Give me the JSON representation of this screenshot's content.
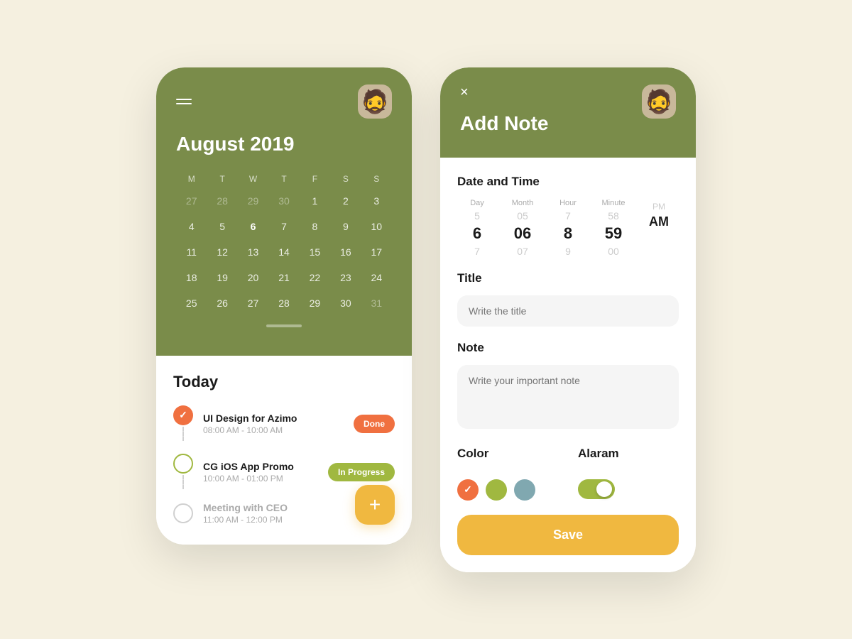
{
  "calendar": {
    "month_title": "August 2019",
    "avatar_emoji": "🧔",
    "day_headers": [
      "M",
      "T",
      "W",
      "T",
      "F",
      "S",
      "S"
    ],
    "weeks": [
      [
        {
          "d": "27",
          "other": true
        },
        {
          "d": "28",
          "other": true
        },
        {
          "d": "29",
          "other": true
        },
        {
          "d": "30",
          "other": true
        },
        {
          "d": "1"
        },
        {
          "d": "2"
        },
        {
          "d": "3"
        }
      ],
      [
        {
          "d": "4"
        },
        {
          "d": "5"
        },
        {
          "d": "6",
          "selected": true
        },
        {
          "d": "7"
        },
        {
          "d": "8"
        },
        {
          "d": "9"
        },
        {
          "d": "10"
        }
      ],
      [
        {
          "d": "11"
        },
        {
          "d": "12"
        },
        {
          "d": "13"
        },
        {
          "d": "14"
        },
        {
          "d": "15"
        },
        {
          "d": "16"
        },
        {
          "d": "17"
        }
      ],
      [
        {
          "d": "18"
        },
        {
          "d": "19"
        },
        {
          "d": "20"
        },
        {
          "d": "21"
        },
        {
          "d": "22"
        },
        {
          "d": "23"
        },
        {
          "d": "24"
        }
      ],
      [
        {
          "d": "25"
        },
        {
          "d": "26"
        },
        {
          "d": "27"
        },
        {
          "d": "28"
        },
        {
          "d": "29"
        },
        {
          "d": "30"
        },
        {
          "d": "31",
          "other": true
        }
      ]
    ],
    "today_label": "Today",
    "tasks": [
      {
        "name": "UI Design for Azimo",
        "time": "08:00 AM - 10:00 AM",
        "status": "done",
        "badge": "Done"
      },
      {
        "name": "CG iOS App Promo",
        "time": "10:00 AM - 01:00 PM",
        "status": "in-progress",
        "badge": "In Progress"
      },
      {
        "name": "Meeting with CEO",
        "time": "11:00 AM - 12:00 PM",
        "status": "pending",
        "badge": ""
      }
    ],
    "fab_label": "+"
  },
  "note": {
    "close_label": "×",
    "title": "Add Note",
    "datetime_label": "Date and Time",
    "col_labels": [
      "Day",
      "Month",
      "Hour",
      "Minute",
      ""
    ],
    "day_above": "5",
    "day_value": "6",
    "day_below": "7",
    "month_above": "05",
    "month_value": "06",
    "month_below": "07",
    "hour_above": "7",
    "hour_value": "8",
    "hour_below": "9",
    "minute_above": "58",
    "minute_value": "59",
    "minute_below": "00",
    "ampm_above": "PM",
    "ampm_value": "AM",
    "title_label": "Title",
    "title_placeholder": "Write the title",
    "note_label": "Note",
    "note_placeholder": "Write your important note",
    "color_label": "Color",
    "alarm_label": "Alaram",
    "colors": [
      {
        "hex": "#f07040",
        "selected": true
      },
      {
        "hex": "#a0b840",
        "selected": false
      },
      {
        "hex": "#80a8b0",
        "selected": false
      }
    ],
    "save_label": "Save"
  },
  "bg_color": "#f5f0e0"
}
